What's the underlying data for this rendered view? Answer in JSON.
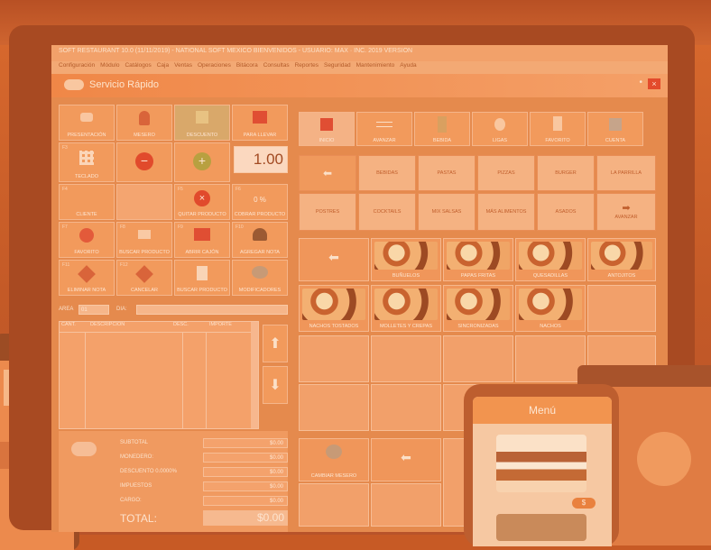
{
  "titlebar": {
    "text": "SOFT RESTAURANT 10.0 (11/11/2019) - NATIONAL SOFT MEXICO BIENVENIDOS - USUARIO: MAX · INC. 2019 VERSION"
  },
  "menubar": {
    "items": [
      "Configuración",
      "Módulo",
      "Catálogos",
      "Caja",
      "Ventas",
      "Operaciones",
      "Bitácora",
      "Consultas",
      "Reportes",
      "Seguridad",
      "Mantenimiento",
      "Ayuda"
    ]
  },
  "window": {
    "title": "Servicio Rápido",
    "close": "×"
  },
  "left_buttons": [
    {
      "label": "Presentación",
      "num": ""
    },
    {
      "label": "Mesero",
      "num": ""
    },
    {
      "label": "Descuento",
      "num": ""
    },
    {
      "label": "Para llevar",
      "num": ""
    },
    {
      "label": "Teclado",
      "num": "F3"
    },
    {
      "label": "",
      "num": ""
    },
    {
      "label": "",
      "num": ""
    },
    {
      "label": "Cliente",
      "num": "F4"
    },
    {
      "label": "",
      "num": ""
    },
    {
      "label": "Quitar producto",
      "num": "F5"
    },
    {
      "label": "Cobrar producto",
      "num": "F6"
    },
    {
      "label": "Favorito",
      "num": "F7"
    },
    {
      "label": "Buscar producto",
      "num": "F8"
    },
    {
      "label": "Abrir cajón",
      "num": "F9"
    },
    {
      "label": "Agregar nota",
      "num": "F10"
    },
    {
      "label": "Eliminar nota",
      "num": "F11"
    },
    {
      "label": "Cancelar",
      "num": "F12"
    },
    {
      "label": "Modificadores",
      "num": ""
    }
  ],
  "quantity": {
    "value": "1.00",
    "percent": "0 %"
  },
  "area": {
    "label": "AREA",
    "value": "01",
    "dia_label": "DIA:"
  },
  "table": {
    "headers": [
      "CANT.",
      "DESCRIPCION",
      "DESC.",
      "IMPORTE"
    ]
  },
  "top_icons": [
    {
      "label": "Inicio"
    },
    {
      "label": "Avanzar"
    },
    {
      "label": "Bebida"
    },
    {
      "label": "Ligas"
    },
    {
      "label": "Favorito"
    },
    {
      "label": "Cuenta"
    }
  ],
  "categories": [
    {
      "label": ""
    },
    {
      "label": "Bebidas"
    },
    {
      "label": "Pastas"
    },
    {
      "label": "Pizzas"
    },
    {
      "label": "Burger"
    },
    {
      "label": "La Parrilla"
    },
    {
      "label": "Postres"
    },
    {
      "label": "Cocktails"
    },
    {
      "label": "Mix Salsas"
    },
    {
      "label": "Más alimentos"
    },
    {
      "label": "Asados"
    },
    {
      "label": "Avanzar"
    }
  ],
  "products": [
    {
      "label": ""
    },
    {
      "label": "Buñuelos"
    },
    {
      "label": "Papas fritas"
    },
    {
      "label": "Quesadillas"
    },
    {
      "label": "Antojitos"
    },
    {
      "label": "Nachos tostados"
    },
    {
      "label": "Molletes y crepas"
    },
    {
      "label": "Sincronizadas"
    },
    {
      "label": "Nachos"
    }
  ],
  "bottom_buttons": [
    {
      "label": "Cambiar mesero"
    },
    {
      "label": ""
    }
  ],
  "summary": {
    "rows": [
      {
        "label": "SUBTOTAL",
        "value": "$0.00"
      },
      {
        "label": "MONEDERO:",
        "value": "$0.00"
      },
      {
        "label": "DESCUENTO 0.0000%",
        "value": "$0.00"
      },
      {
        "label": "IMPUESTOS",
        "value": "$0.00"
      },
      {
        "label": "CARGO:",
        "value": "$0.00"
      }
    ],
    "total_label": "TOTAL:",
    "total_value": "$0.00"
  },
  "phone": {
    "title": "Menú"
  }
}
